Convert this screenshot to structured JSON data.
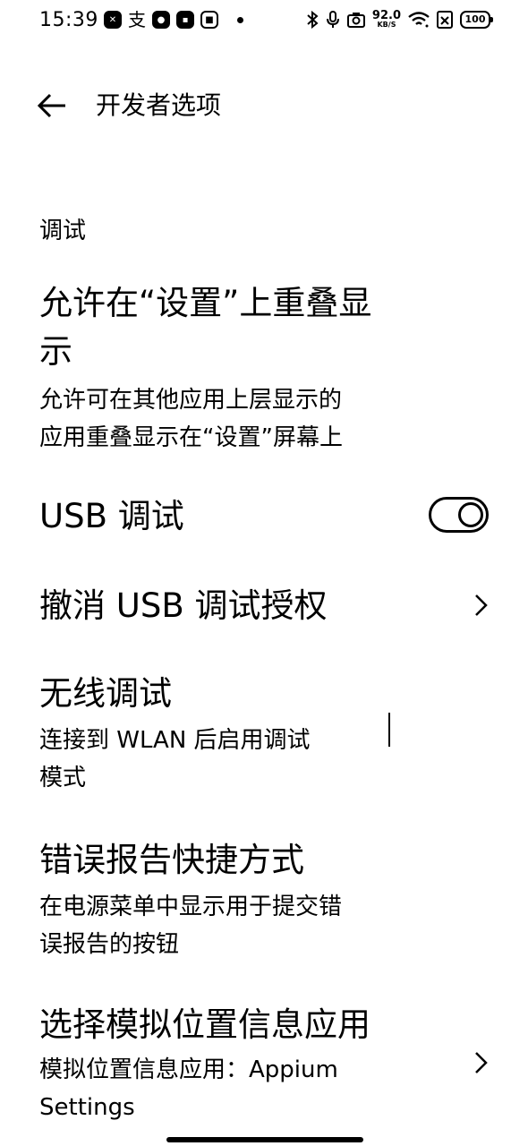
{
  "status_bar": {
    "time": "15:39",
    "net_speed_value": "92.0",
    "net_speed_unit": "KB/S",
    "battery": "100",
    "notification_icons": [
      "app-icon",
      "alipay-icon",
      "app-icon",
      "app-icon",
      "app-icon"
    ],
    "system_icons": [
      "bluetooth-icon",
      "microphone-icon",
      "camera-icon",
      "wifi-icon",
      "sim-off-icon",
      "battery-icon"
    ]
  },
  "header": {
    "title": "开发者选项"
  },
  "section": {
    "title": "调试"
  },
  "items": [
    {
      "title_line1": "允许在“设置”上重叠显",
      "title_line2": "示",
      "subtitle_line1": "允许可在其他应用上层显示的",
      "subtitle_line2": "应用重叠显示在“设置”屏幕上"
    },
    {
      "title": "USB 调试",
      "toggle_state": "on"
    },
    {
      "title": "撤消 USB 调试授权"
    },
    {
      "title": "无线调试",
      "subtitle_line1": "连接到 WLAN 后启用调试",
      "subtitle_line2": "模式"
    },
    {
      "title": "错误报告快捷方式",
      "subtitle_line1": "在电源菜单中显示用于提交错",
      "subtitle_line2": "误报告的按钮"
    },
    {
      "title": "选择模拟位置信息应用",
      "subtitle_line1": "模拟位置信息应用：Appium",
      "subtitle_line2": "Settings"
    }
  ]
}
